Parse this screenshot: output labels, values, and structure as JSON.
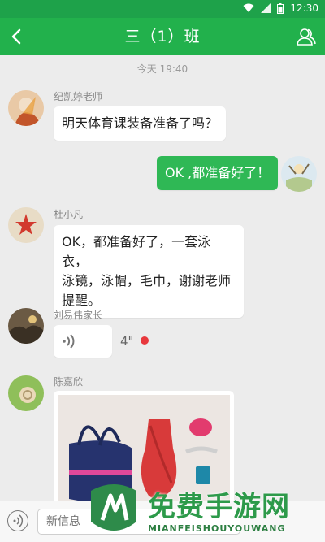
{
  "status_bar": {
    "time": "12:30"
  },
  "nav": {
    "title": "三（1）班"
  },
  "timestamp": "今天 19:40",
  "messages": [
    {
      "sender": "纪凯婷老师",
      "text": "明天体育课装备准备了吗？"
    },
    {
      "text": "OK ,都准备好了！"
    },
    {
      "sender": "杜小凡",
      "lines": [
        "OK，都准备好了，一套泳衣，",
        "泳镜，泳帽，毛巾，谢谢老师",
        "提醒。"
      ]
    },
    {
      "sender": "刘易伟家长",
      "voice_duration": "4\""
    },
    {
      "sender": "陈嘉欣"
    }
  ],
  "input": {
    "placeholder": "新信息"
  },
  "watermark": {
    "brand_cn": "免费手游网",
    "brand_en": "MIANFEISHOUYOUWANG"
  },
  "colors": {
    "header": "#22b14c",
    "status_bar": "#1ea24a",
    "my_bubble": "#2fb855",
    "unread_dot": "#e8383d"
  }
}
